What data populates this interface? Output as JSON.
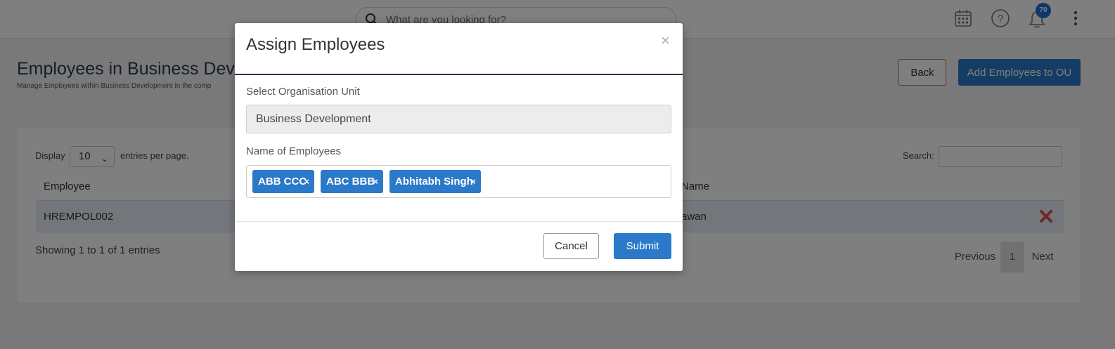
{
  "topbar": {
    "search_placeholder": "What are you looking for?",
    "notification_count": "70",
    "icons": [
      "search-icon",
      "calendar-icon",
      "help-icon",
      "bell-icon",
      "more-vertical-icon"
    ]
  },
  "page": {
    "title": "Employees in Business Devel",
    "subtitle": "Manage Employees within Business Development in the comp",
    "back_label": "Back",
    "add_label": "Add Employees to OU"
  },
  "table": {
    "display_label": "Display",
    "entries_value": "10",
    "entries_suffix": "entries per page.",
    "search_label": "Search:",
    "columns": [
      "Employee",
      "Name"
    ],
    "rows": [
      {
        "employee": "HREMPOL002",
        "name": "awan"
      }
    ],
    "info": "Showing 1 to 1 of 1 entries",
    "pagination": {
      "previous": "Previous",
      "current": "1",
      "next": "Next"
    }
  },
  "modal": {
    "title": "Assign Employees",
    "close_glyph": "×",
    "ou_label": "Select Organisation Unit",
    "ou_value": "Business Development",
    "employees_label": "Name of Employees",
    "selected_employees": [
      "ABB CCC",
      "ABC BBB",
      "Abhitabh Singh"
    ],
    "tag_remove_glyph": "×",
    "cancel_label": "Cancel",
    "submit_label": "Submit"
  },
  "colors": {
    "primary": "#2b79c9",
    "badge": "#1d6fd6",
    "delete": "#d9534f",
    "title_text": "#2b3a55"
  }
}
